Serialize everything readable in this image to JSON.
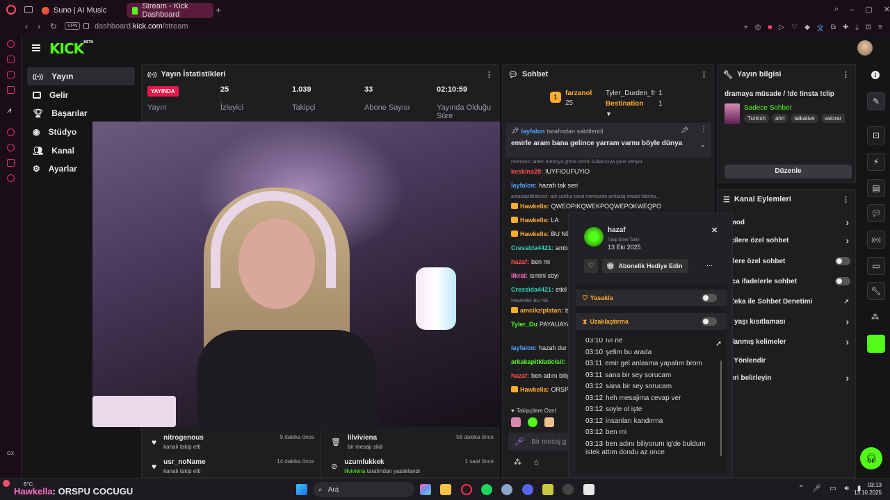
{
  "browser": {
    "tabs": [
      {
        "label": "Suno | AI Music",
        "active": false
      },
      {
        "label": "Stream - Kick Dashboard",
        "active": true
      }
    ],
    "vpn_badge": "VPN",
    "url_prefix": "dashboard.",
    "url_domain": "kick.com",
    "url_path": "/stream"
  },
  "header": {
    "logo": "KICK",
    "logo_tag": "BETA"
  },
  "sidebar": {
    "items": [
      {
        "label": "Yayın",
        "icon": "broadcast-icon",
        "selected": true
      },
      {
        "label": "Gelir",
        "icon": "wallet-icon"
      },
      {
        "label": "Başarılar",
        "icon": "trophy-icon"
      },
      {
        "label": "Stüdyo",
        "icon": "camera-icon"
      },
      {
        "label": "Kanal",
        "icon": "users-icon"
      },
      {
        "label": "Ayarlar",
        "icon": "gear-icon"
      }
    ]
  },
  "stats": {
    "title": "Yayın İstatistikleri",
    "live_badge": "YAYINDA",
    "live_label": "Yayın",
    "items": [
      {
        "value": "25",
        "label": "İzleyici"
      },
      {
        "value": "1.039",
        "label": "Takipçi"
      },
      {
        "value": "33",
        "label": "Abone Sayısı"
      },
      {
        "value": "02:10:59",
        "label": "Yayında Olduğu Süre"
      }
    ]
  },
  "feed": {
    "left": [
      {
        "name": "nitrogenous",
        "text": "kanalı takip etti",
        "time": "9 dakika önce"
      },
      {
        "name": "usr_noName",
        "text": "kanalı takip etti",
        "time": "14 dakika önce"
      }
    ],
    "right": [
      {
        "name": "lilviviena",
        "text": "bir mesajı sildi",
        "time": "58 dakika önce"
      },
      {
        "name": "uzumlukkek",
        "text": "tarafından yasaklandı",
        "sub_name": "lilviviena",
        "time": "1 saat önce"
      }
    ]
  },
  "chat": {
    "title": "Sohbet",
    "leaderboard": [
      {
        "rank": "1",
        "name": "farzanol",
        "count": "25"
      },
      {
        "name": "Tyler_Durden_fr",
        "count": "1"
      },
      {
        "name": "Bestination",
        "count": "1"
      }
    ],
    "pinned_by": "layfalon",
    "pinned_by_suffix": "tarafından sabitlendi",
    "pinned_text": "emirle aram bana gelince yarram varmı böyle dünya",
    "messages": [
      {
        "user": "keskins28:",
        "text": "IUYFIOUFUYIO",
        "color": "u-red",
        "reply": "reonnois: tatlen metroya gitme ismini kullanıcıya yanıt veriyor"
      },
      {
        "user": "layfalon:",
        "text": "hazafı tak seri",
        "color": "u-blue"
      },
      {
        "user": "Hawkella:",
        "text": "QWEOPIKQWEKPOQWEPOKWEQPO",
        "color": "u-orange",
        "reply": "arkakapitklaticisii: adı şahika tokat merkezde ambalaj imalat fabrika..."
      },
      {
        "user": "Hawkella:",
        "text": "LA",
        "color": "u-orange"
      },
      {
        "user": "Hawkella:",
        "text": "BU NE",
        "color": "u-orange"
      },
      {
        "user": "Cressida4421:",
        "text": "amba",
        "color": "u-teal"
      },
      {
        "user": "hazaf:",
        "text": "ben mi",
        "color": "u-red"
      },
      {
        "user": "likral:",
        "text": "ismini söyl",
        "color": "u-pink"
      },
      {
        "user": "Cressida4421:",
        "text": "etkil",
        "color": "u-teal"
      },
      {
        "user": "amcikziplatan:",
        "text": "beno",
        "color": "u-orange",
        "reply": "Hawkella: BU NE"
      },
      {
        "user": "Tyler_Du",
        "text": "PAYAUAYAHAHAKAHAKAKSKQLSJAKKXQ",
        "color": "u-green"
      },
      {
        "user": "layfalon:",
        "text": "hazafı dur c",
        "color": "u-blue"
      },
      {
        "user": "arkakapitklaticisii:",
        "text": "",
        "color": "u-green"
      },
      {
        "user": "hazaf:",
        "text": "ben adını biliy",
        "color": "u-red"
      },
      {
        "user": "Hawkella:",
        "text": "ORSP",
        "color": "u-orange"
      }
    ],
    "follower_only_label": "Takipçilere Özel",
    "input_placeholder": "Bir mesaj g"
  },
  "popup": {
    "username": "hazaf",
    "follow_date_label": "Takip Etme Tarihi",
    "follow_date": "13 Eki 2025",
    "gift_button": "Abonelik Hediye Edin",
    "ban_label": "Yasakla",
    "timeout_label": "Uzaklaştırma",
    "history": [
      {
        "time": "03:10",
        "text": "ıvı ne"
      },
      {
        "time": "03:10",
        "text": "şefim bu arada"
      },
      {
        "time": "03:11",
        "text": "emir gel anlasma yapalım brom"
      },
      {
        "time": "03:11",
        "text": "sana bir sey sorucam"
      },
      {
        "time": "03:12",
        "text": "sana bir sey sorucam"
      },
      {
        "time": "03:12",
        "text": "heh mesajima cevap ver"
      },
      {
        "time": "03:12",
        "text": "soyle ol işte"
      },
      {
        "time": "03:12",
        "text": "insanları kandırma"
      },
      {
        "time": "03:12",
        "text": "ben mi"
      },
      {
        "time": "03:13",
        "text": "ben adını biliyorum ig'de buldum istek attım dondu az once"
      }
    ]
  },
  "stream_info": {
    "title": "Yayın bilgisi",
    "stream_title": "dramaya müsade / !dc !insta !clip",
    "category": "Sadece Sohbet",
    "tags": [
      "Turkish",
      "ahri",
      "talkative",
      "valorar"
    ],
    "edit_button": "Düzenle"
  },
  "channel_actions": {
    "title": "Kanal Eylemleri",
    "rows": [
      {
        "label": "aş mod",
        "control": "chevron"
      },
      {
        "label": "kipçilere özel sohbet",
        "control": "chevron"
      },
      {
        "label": "onelere özel sohbet",
        "control": "toggle"
      },
      {
        "label": "ınızca ifadelerle sohbet",
        "control": "toggle"
      },
      {
        "label": "ay Zeka ile Sohbet Denetimi",
        "control": "external"
      },
      {
        "label": "sap yaşı kısıtlaması",
        "control": "chevron"
      },
      {
        "label": "saklanmış kelimeler",
        "control": "chevron"
      },
      {
        "label": "yici Yönlendir",
        "control": "none"
      },
      {
        "label": "lefleri belirleyin",
        "control": "chevron"
      }
    ]
  },
  "taskbar": {
    "weather_temp": "6°C",
    "ticker_user": "Hawkella",
    "ticker_text": ": ORSPU COCUGU",
    "search": "Ara",
    "time": "03:13",
    "date": "13.10.2025"
  },
  "colors": {
    "kick_green": "#53fc18",
    "live_red": "#e5184a",
    "browser_accent": "#5a1b3c"
  }
}
